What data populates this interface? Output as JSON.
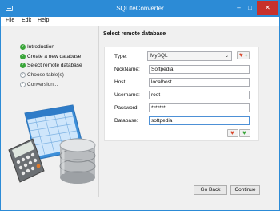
{
  "window": {
    "title": "SQLiteConverter",
    "minimize": "–",
    "maximize": "□",
    "close": "✕"
  },
  "menu": [
    "File",
    "Edit",
    "Help"
  ],
  "steps": [
    {
      "label": "Introduction",
      "done": true
    },
    {
      "label": "Create a new database",
      "done": true
    },
    {
      "label": "Select remote database",
      "done": true
    },
    {
      "label": "Choose table(s)",
      "done": false
    },
    {
      "label": "Conversion...",
      "done": false
    }
  ],
  "section_title": "Select remote database",
  "form": {
    "type_label": "Type:",
    "type_value": "MySQL",
    "nickname_label": "NickName:",
    "nickname_value": "Softpedia",
    "host_label": "Host:",
    "host_value": "localhost",
    "username_label": "Username:",
    "username_value": "root",
    "password_label": "Password:",
    "password_value": "*******",
    "database_label": "Database:",
    "database_value": "softpedia"
  },
  "buttons": {
    "back": "Go Back",
    "continue": "Continue"
  },
  "icons": {
    "check": "✓",
    "chevron": "⌄",
    "heart": "♥",
    "plus": "+"
  },
  "colors": {
    "titlebar": "#2c8bd6",
    "done": "#3aa53a",
    "heart": "#d9472b",
    "close": "#c7312c"
  }
}
